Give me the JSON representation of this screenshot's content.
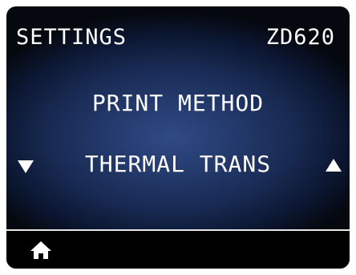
{
  "header": {
    "title": "SETTINGS",
    "model": "ZD620"
  },
  "setting": {
    "name": "PRINT METHOD",
    "value": "THERMAL TRANS"
  },
  "icons": {
    "prev": "triangle-down-icon",
    "next": "triangle-up-icon",
    "home": "home-icon"
  },
  "colors": {
    "text": "#ffffff",
    "background_center": "#2f4a86",
    "background_edge": "#05080f",
    "divider": "#e6e6e6"
  }
}
